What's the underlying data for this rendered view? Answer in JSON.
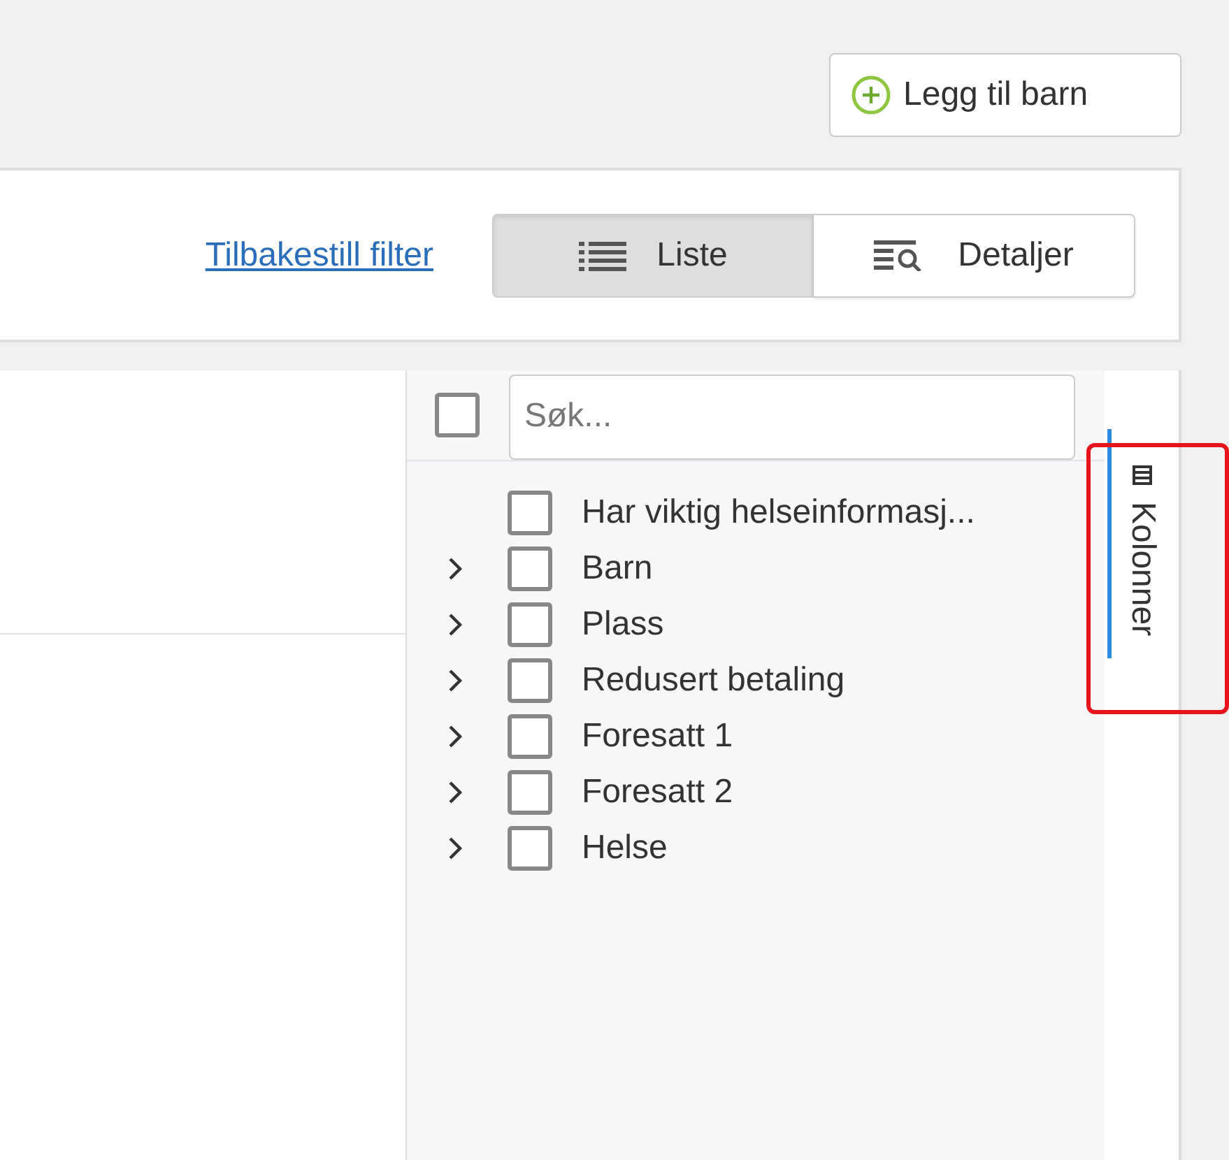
{
  "add_button": {
    "label": "Legg til barn"
  },
  "filter_bar": {
    "reset_link": "Tilbakestill filter",
    "view_toggle": [
      {
        "label": "Liste",
        "selected": true
      },
      {
        "label": "Detaljer",
        "selected": false
      }
    ]
  },
  "column_panel": {
    "select_all": {
      "checked": false
    },
    "search": {
      "placeholder": "Søk..."
    },
    "items": [
      {
        "label": "Har viktig helseinformasj...",
        "expandable": false,
        "checked": false
      },
      {
        "label": "Barn",
        "expandable": true,
        "checked": false
      },
      {
        "label": "Plass",
        "expandable": true,
        "checked": false
      },
      {
        "label": "Redusert betaling",
        "expandable": true,
        "checked": false
      },
      {
        "label": "Foresatt 1",
        "expandable": true,
        "checked": false
      },
      {
        "label": "Foresatt 2",
        "expandable": true,
        "checked": false
      },
      {
        "label": "Helse",
        "expandable": true,
        "checked": false
      }
    ]
  },
  "side_tabs": [
    {
      "label": "Kolonner",
      "selected": true
    }
  ],
  "annotation": {
    "kind": "highlight-box"
  }
}
